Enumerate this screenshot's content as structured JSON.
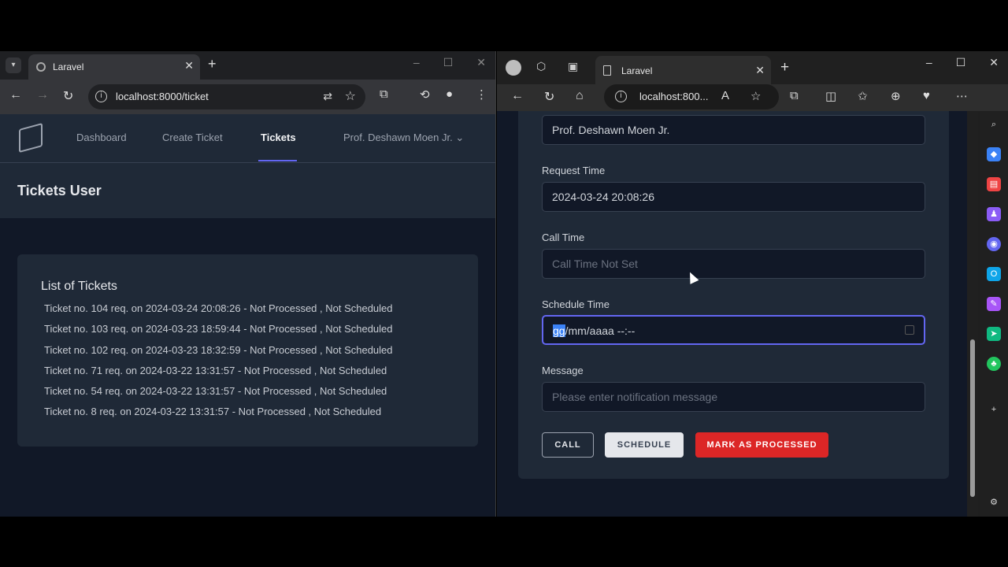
{
  "left_browser": {
    "tab_title": "Laravel",
    "url": "localhost:8000/ticket"
  },
  "app": {
    "nav": {
      "dashboard": "Dashboard",
      "create_ticket": "Create Ticket",
      "tickets": "Tickets",
      "user": "Prof. Deshawn Moen Jr."
    },
    "header_title": "Tickets User",
    "list_title": "List of Tickets",
    "tickets": [
      "Ticket no. 104 req. on 2024-03-24 20:08:26 - Not Processed , Not Scheduled",
      "Ticket no. 103 req. on 2024-03-23 18:59:44 - Not Processed , Not Scheduled",
      "Ticket no. 102 req. on 2024-03-23 18:32:59 - Not Processed , Not Scheduled",
      "Ticket no. 71 req. on 2024-03-22 13:31:57 - Not Processed , Not Scheduled",
      "Ticket no. 54 req. on 2024-03-22 13:31:57 - Not Processed , Not Scheduled",
      "Ticket no. 8 req. on 2024-03-22 13:31:57 - Not Processed , Not Scheduled"
    ]
  },
  "right_browser": {
    "tab_title": "Laravel",
    "url": "localhost:800..."
  },
  "form": {
    "user_value": "Prof. Deshawn Moen Jr.",
    "request_time_label": "Request Time",
    "request_time_value": "2024-03-24 20:08:26",
    "call_time_label": "Call Time",
    "call_time_placeholder": "Call Time Not Set",
    "schedule_time_label": "Schedule Time",
    "schedule_time_sel": "gg",
    "schedule_time_rest": "/mm/aaaa --:--",
    "message_label": "Message",
    "message_placeholder": "Please enter notification message",
    "buttons": {
      "call": "CALL",
      "schedule": "SCHEDULE",
      "mark_processed": "MARK AS PROCESSED"
    }
  },
  "colors": {
    "accent": "#6366f1",
    "danger": "#dc2626"
  }
}
